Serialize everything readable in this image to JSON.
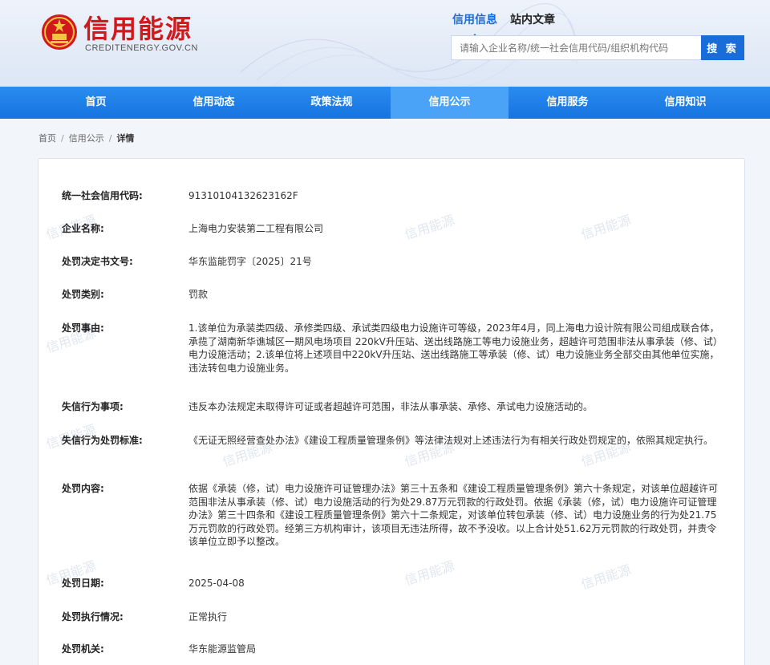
{
  "site": {
    "title": "信用能源",
    "url": "CREDITENERGY.GOV.CN"
  },
  "search": {
    "tabs": [
      "信用信息",
      "站内文章"
    ],
    "active_tab": 0,
    "placeholder": "请输入企业名称/统一社会信用代码/组织机构代码",
    "button_label": "搜 索"
  },
  "nav": {
    "items": [
      "首页",
      "信用动态",
      "政策法规",
      "信用公示",
      "信用服务",
      "信用知识"
    ],
    "active": 3
  },
  "breadcrumb": {
    "items": [
      "首页",
      "信用公示",
      "详情"
    ],
    "separator": "/"
  },
  "watermark_text": "信用能源",
  "details": [
    {
      "label": "统一社会信用代码:",
      "value": "91310104132623162F"
    },
    {
      "label": "企业名称:",
      "value": "上海电力安装第二工程有限公司"
    },
    {
      "label": "处罚决定书文号:",
      "value": "华东监能罚字〔2025〕21号"
    },
    {
      "label": "处罚类别:",
      "value": "罚款"
    },
    {
      "label": "处罚事由:",
      "value": "1.该单位为承装类四级、承修类四级、承试类四级电力设施许可等级，2023年4月，同上海电力设计院有限公司组成联合体，承揽了湖南新华谯城区一期风电场项目 220kV升压站、送出线路施工等电力设施业务，超越许可范围非法从事承装（修、试）电力设施活动；2.该单位将上述项目中220kV升压站、送出线路施工等承装（修、试）电力设施业务全部交由其他单位实施，违法转包电力设施业务。"
    },
    {
      "label": "失信行为事项:",
      "value": "违反本办法规定未取得许可证或者超越许可范围，非法从事承装、承修、承试电力设施活动的。"
    },
    {
      "label": "失信行为处罚标准:",
      "value": "《无证无照经营查处办法》《建设工程质量管理条例》等法律法规对上述违法行为有相关行政处罚规定的，依照其规定执行。"
    },
    {
      "label": "处罚内容:",
      "value": "依据《承装（修，试）电力设施许可证管理办法》第三十五条和《建设工程质量管理条例》第六十条规定，对该单位超越许可范围非法从事承装（修、试）电力设施活动的行为处29.87万元罚款的行政处罚。依据《承装（修，试）电力设施许可证管理办法》第三十四条和《建设工程质量管理条例》第六十二条规定，对该单位转包承装（修、试）电力设施业务的行为处21.75万元罚款的行政处罚。经第三方机构审计，该项目无违法所得，故不予没收。以上合计处51.62万元罚款的行政处罚，并责令该单位立即予以整改。"
    },
    {
      "label": "处罚日期:",
      "value": "2025-04-08"
    },
    {
      "label": "处罚执行情况:",
      "value": "正常执行"
    },
    {
      "label": "处罚机关:",
      "value": "华东能源监管局"
    }
  ],
  "colors": {
    "brand_red": "#d0191d",
    "nav_blue": "#1a6cd8",
    "nav_active": "#4aa3f6"
  }
}
